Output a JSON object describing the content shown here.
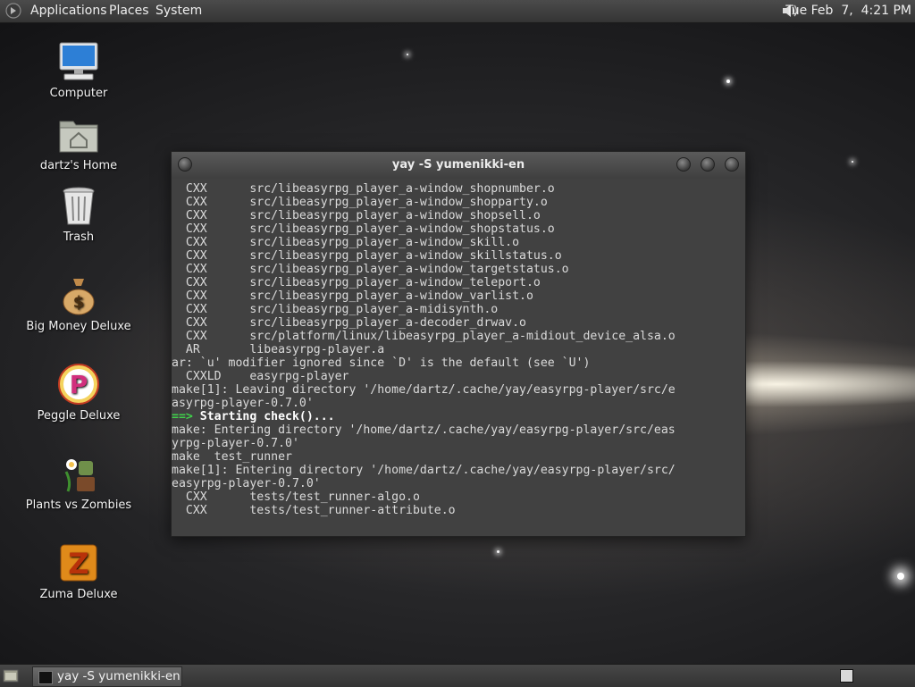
{
  "top_panel": {
    "menus": [
      "Applications",
      "Places",
      "System"
    ],
    "clock": "Tue Feb  7,  4:21 PM",
    "icons": {
      "menu": "foot-logo-icon",
      "volume": "speaker-icon"
    }
  },
  "desktop_icons": [
    {
      "label": "Computer",
      "icon": "computer-icon"
    },
    {
      "label": "dartz's Home",
      "icon": "home-folder-icon"
    },
    {
      "label": "Trash",
      "icon": "trash-icon"
    },
    {
      "label": "Big Money Deluxe",
      "icon": "money-bag-icon"
    },
    {
      "label": "Peggle Deluxe",
      "icon": "peggle-icon"
    },
    {
      "label": "Plants vs Zombies",
      "icon": "plants-vs-zombies-icon"
    },
    {
      "label": "Zuma Deluxe",
      "icon": "zuma-icon"
    }
  ],
  "terminal": {
    "title": "yay -S yumenikki-en",
    "lines": [
      "  CXX      src/libeasyrpg_player_a-window_shopnumber.o",
      "  CXX      src/libeasyrpg_player_a-window_shopparty.o",
      "  CXX      src/libeasyrpg_player_a-window_shopsell.o",
      "  CXX      src/libeasyrpg_player_a-window_shopstatus.o",
      "  CXX      src/libeasyrpg_player_a-window_skill.o",
      "  CXX      src/libeasyrpg_player_a-window_skillstatus.o",
      "  CXX      src/libeasyrpg_player_a-window_targetstatus.o",
      "  CXX      src/libeasyrpg_player_a-window_teleport.o",
      "  CXX      src/libeasyrpg_player_a-window_varlist.o",
      "  CXX      src/libeasyrpg_player_a-midisynth.o",
      "  CXX      src/libeasyrpg_player_a-decoder_drwav.o",
      "  CXX      src/platform/linux/libeasyrpg_player_a-midiout_device_alsa.o",
      "  AR       libeasyrpg-player.a",
      "ar: `u' modifier ignored since `D' is the default (see `U')",
      "  CXXLD    easyrpg-player",
      "make[1]: Leaving directory '/home/dartz/.cache/yay/easyrpg-player/src/e",
      "asyrpg-player-0.7.0'",
      "",
      "make: Entering directory '/home/dartz/.cache/yay/easyrpg-player/src/eas",
      "yrpg-player-0.7.0'",
      "make  test_runner",
      "make[1]: Entering directory '/home/dartz/.cache/yay/easyrpg-player/src/",
      "easyrpg-player-0.7.0'",
      "  CXX      tests/test_runner-algo.o",
      "  CXX      tests/test_runner-attribute.o"
    ],
    "highlight_line": {
      "arrow": "==>",
      "text": " Starting check()..."
    }
  },
  "bottom_panel": {
    "task_label": "yay -S yumenikki-en",
    "icons": {
      "show_desktop": "show-desktop-icon",
      "terminal": "terminal-icon",
      "workspace": "workspace-switcher-icon"
    }
  }
}
